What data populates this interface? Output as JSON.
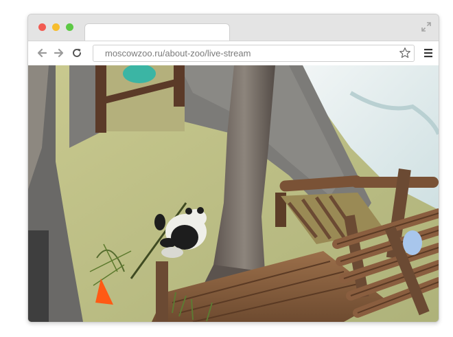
{
  "browser": {
    "address_bar": {
      "url": "moscowzoo.ru/about-zoo/live-stream"
    },
    "icons": {
      "back": "back-arrow-icon",
      "forward": "forward-arrow-icon",
      "reload": "reload-icon",
      "bookmark": "star-icon",
      "menu": "hamburger-menu-icon",
      "fullscreen": "expand-icon"
    },
    "colors": {
      "close": "#f25b52",
      "minimize": "#f7bd2e",
      "zoom": "#5dc945"
    }
  }
}
